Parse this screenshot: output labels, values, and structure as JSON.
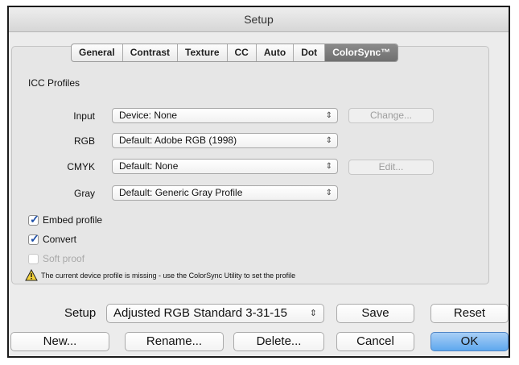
{
  "window": {
    "title": "Setup"
  },
  "tabs": [
    {
      "label": "General"
    },
    {
      "label": "Contrast"
    },
    {
      "label": "Texture"
    },
    {
      "label": "CC"
    },
    {
      "label": "Auto"
    },
    {
      "label": "Dot"
    },
    {
      "label": "ColorSync™",
      "active": true
    }
  ],
  "icc": {
    "heading": "ICC Profiles",
    "input": {
      "label": "Input",
      "value": "Device: None",
      "button": "Change..."
    },
    "rgb": {
      "label": "RGB",
      "value": "Default: Adobe RGB (1998)"
    },
    "cmyk": {
      "label": "CMYK",
      "value": "Default: None",
      "button": "Edit..."
    },
    "gray": {
      "label": "Gray",
      "value": "Default: Generic Gray Profile"
    }
  },
  "options": {
    "embed": {
      "label": "Embed profile",
      "checked": true
    },
    "convert": {
      "label": "Convert",
      "checked": true
    },
    "softproof": {
      "label": "Soft proof",
      "checked": false,
      "disabled": true
    }
  },
  "warning_text": "The current device profile is missing - use the ColorSync Utility to set the profile",
  "footer": {
    "setup_label": "Setup",
    "setup_value": "Adjusted RGB Standard 3-31-15",
    "save": "Save",
    "reset": "Reset",
    "new": "New...",
    "rename": "Rename...",
    "delete": "Delete...",
    "cancel": "Cancel",
    "ok": "OK"
  },
  "icons": {
    "select_arrows": "⇕",
    "checkmark": "✓"
  }
}
